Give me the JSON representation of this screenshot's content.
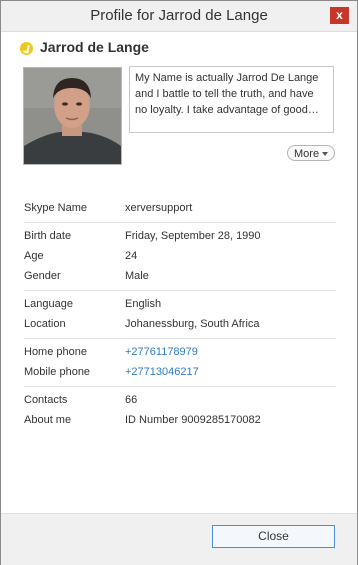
{
  "window": {
    "title": "Profile for Jarrod de Lange",
    "close_glyph": "x"
  },
  "profile": {
    "name": "Jarrod de Lange",
    "status": "away",
    "status_color": "#f2c71c",
    "mood": "My Name is actually Jarrod De Lange and I battle to tell the truth, and have no loyalty. I take advantage of good peop...",
    "more_label": "More"
  },
  "details": {
    "skype_name": {
      "label": "Skype Name",
      "value": "xerversupport"
    },
    "birth_date": {
      "label": "Birth date",
      "value": "Friday, September 28, 1990"
    },
    "age": {
      "label": "Age",
      "value": "24"
    },
    "gender": {
      "label": "Gender",
      "value": "Male"
    },
    "language": {
      "label": "Language",
      "value": "English"
    },
    "location": {
      "label": "Location",
      "value": "Johanessburg, South Africa"
    },
    "home_phone": {
      "label": "Home phone",
      "value": "+27761178979"
    },
    "mobile_phone": {
      "label": "Mobile phone",
      "value": "+27713046217"
    },
    "contacts": {
      "label": "Contacts",
      "value": "66"
    },
    "about_me": {
      "label": "About me",
      "value": "ID Number 9009285170082"
    }
  },
  "footer": {
    "close_label": "Close"
  },
  "colors": {
    "link": "#2f7cc7",
    "close_x_bg": "#c7362a",
    "button_border": "#4a90d9"
  }
}
